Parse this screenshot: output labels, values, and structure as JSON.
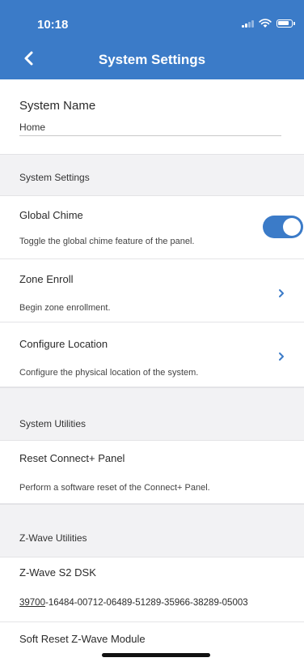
{
  "status_bar": {
    "time": "10:18"
  },
  "header": {
    "title": "System Settings"
  },
  "system_name": {
    "label": "System Name",
    "value": "Home"
  },
  "sections": {
    "system_settings": "System Settings",
    "system_utilities": "System Utilities",
    "zwave_utilities": "Z-Wave Utilities"
  },
  "global_chime": {
    "title": "Global Chime",
    "description": "Toggle the global chime feature of the panel.",
    "enabled": true
  },
  "zone_enroll": {
    "title": "Zone Enroll",
    "description": "Begin zone enrollment."
  },
  "configure_location": {
    "title": "Configure Location",
    "description": "Configure the physical location of the system."
  },
  "reset_panel": {
    "title": "Reset Connect+ Panel",
    "description": "Perform a software reset of the Connect+ Panel."
  },
  "zwave_dsk": {
    "title": "Z-Wave S2 DSK",
    "prefix": "39700",
    "rest": "-16484-00712-06489-51289-35966-38289-05003"
  },
  "soft_reset": {
    "title": "Soft Reset Z-Wave Module"
  },
  "colors": {
    "header_blue": "#3b7bc8",
    "toggle_on": "#3b7bc8",
    "section_bg": "#f2f2f4"
  }
}
